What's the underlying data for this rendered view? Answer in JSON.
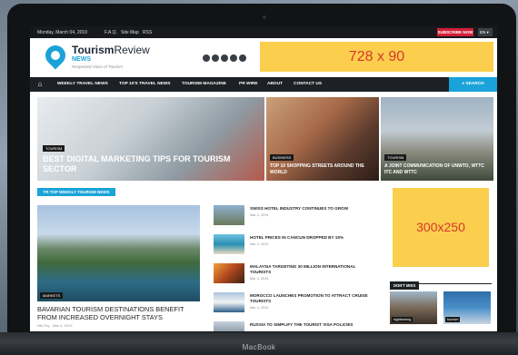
{
  "topbar": {
    "date": "Monday, March 04, 2019",
    "links": [
      "F.A.Q.",
      "Site Map",
      "RSS"
    ],
    "subscribe": "SUBSCRIBE NOW",
    "language": "EN"
  },
  "header": {
    "logo_tourism": "Tourism",
    "logo_review": "Review",
    "logo_news": "NEWS",
    "tagline": "Respected Voice of Tourism",
    "social_icons": [
      "instagram-icon",
      "facebook-icon",
      "twitter-icon",
      "linkedin-icon",
      "rss-icon"
    ],
    "ad_label": "728 x 90"
  },
  "nav": {
    "home_icon": "home-icon",
    "items": [
      "WEEKLY TRAVEL NEWS",
      "TOP 10'S TRAVEL NEWS",
      "TOURISM MAGAZINE",
      "PR WIRE",
      "ABOUT",
      "CONTACT US"
    ],
    "search": "SEARCH"
  },
  "hero": [
    {
      "tag": "TOURISM",
      "title": "BEST DIGITAL MARKETING TIPS FOR TOURISM SECTOR"
    },
    {
      "tag": "BUSINESS",
      "title": "TOP 10 SHOPPING STREETS AROUND THE WORLD"
    },
    {
      "tag": "TOURISM",
      "title": "A JOINT COMMUNICATION OF UNWTO, WTTC ITC AND WTTC"
    }
  ],
  "section_title": "TR TOP WEEKLY TOURISM NEWS",
  "main_story": {
    "tag": "MARKETS",
    "title": "BAVARIAN TOURISM DESTINATIONS BENEFIT FROM INCREASED OVERNIGHT STAYS",
    "meta": "Nik Fey - Mar 4, 2019"
  },
  "news_list": [
    {
      "title": "SWISS HOTEL INDUSTRY CONTINUES TO GROW",
      "date": "Mar 4, 2019"
    },
    {
      "title": "HOTEL PRICES IN CANCUN DROPPED BY 15%",
      "date": "Mar 4, 2019"
    },
    {
      "title": "MALAYSIA TARGETING 30 MILLION INTERNATIONAL TOURISTS",
      "date": "Mar 4, 2019"
    },
    {
      "title": "MOROCCO LAUNCHES PROMOTION TO ATTRACT CRUISE TOURISTS",
      "date": "Mar 4, 2019"
    },
    {
      "title": "RUSSIA TO SIMPLIFY THE TOURIST VISA POLICIES",
      "date": "Mar 4, 2019"
    }
  ],
  "sidebar": {
    "ad_label": "300x250",
    "dont_miss": "DON'T MISS",
    "cards": [
      {
        "tag": "sightseeing"
      },
      {
        "tag": "tourism"
      }
    ]
  },
  "device_label": "MacBook"
}
